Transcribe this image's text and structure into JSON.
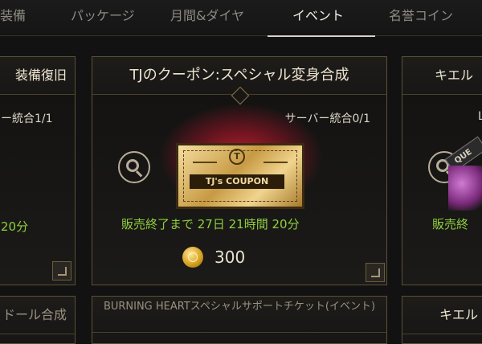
{
  "tabs": [
    {
      "label": "装備",
      "active": false
    },
    {
      "label": "パッケージ",
      "active": false
    },
    {
      "label": "月間&ダイヤ",
      "active": false
    },
    {
      "label": "イベント",
      "active": true
    },
    {
      "label": "名誉コイン",
      "active": false
    }
  ],
  "cards": {
    "left": {
      "title": "装備復旧",
      "server": "ー統合1/1",
      "countdown": "20分",
      "bottom_title": "ドール合成"
    },
    "center": {
      "title": "TJのクーポン:スペシャル変身合成",
      "server": "サーバー統合0/1",
      "coupon_label": "TJ's COUPON",
      "coupon_emblem": "T",
      "countdown": "販売終了まで  27日  21時間  20分",
      "price": "300",
      "bottom_title": "BURNING  HEARTスペシャルサポートチケット(イベント)"
    },
    "right": {
      "title": "キエル",
      "server": "L",
      "ribbon": "QUE",
      "countdown": "販売終",
      "bottom_title": "キエル"
    }
  },
  "colors": {
    "accent_green": "#8fcf3e",
    "frame_gold": "#5d5036",
    "active_tab": "#f4f0e6"
  },
  "icons": {
    "detail": "magnifier-icon",
    "currency": "gold-coin-icon",
    "expand": "corner-expand-icon"
  }
}
